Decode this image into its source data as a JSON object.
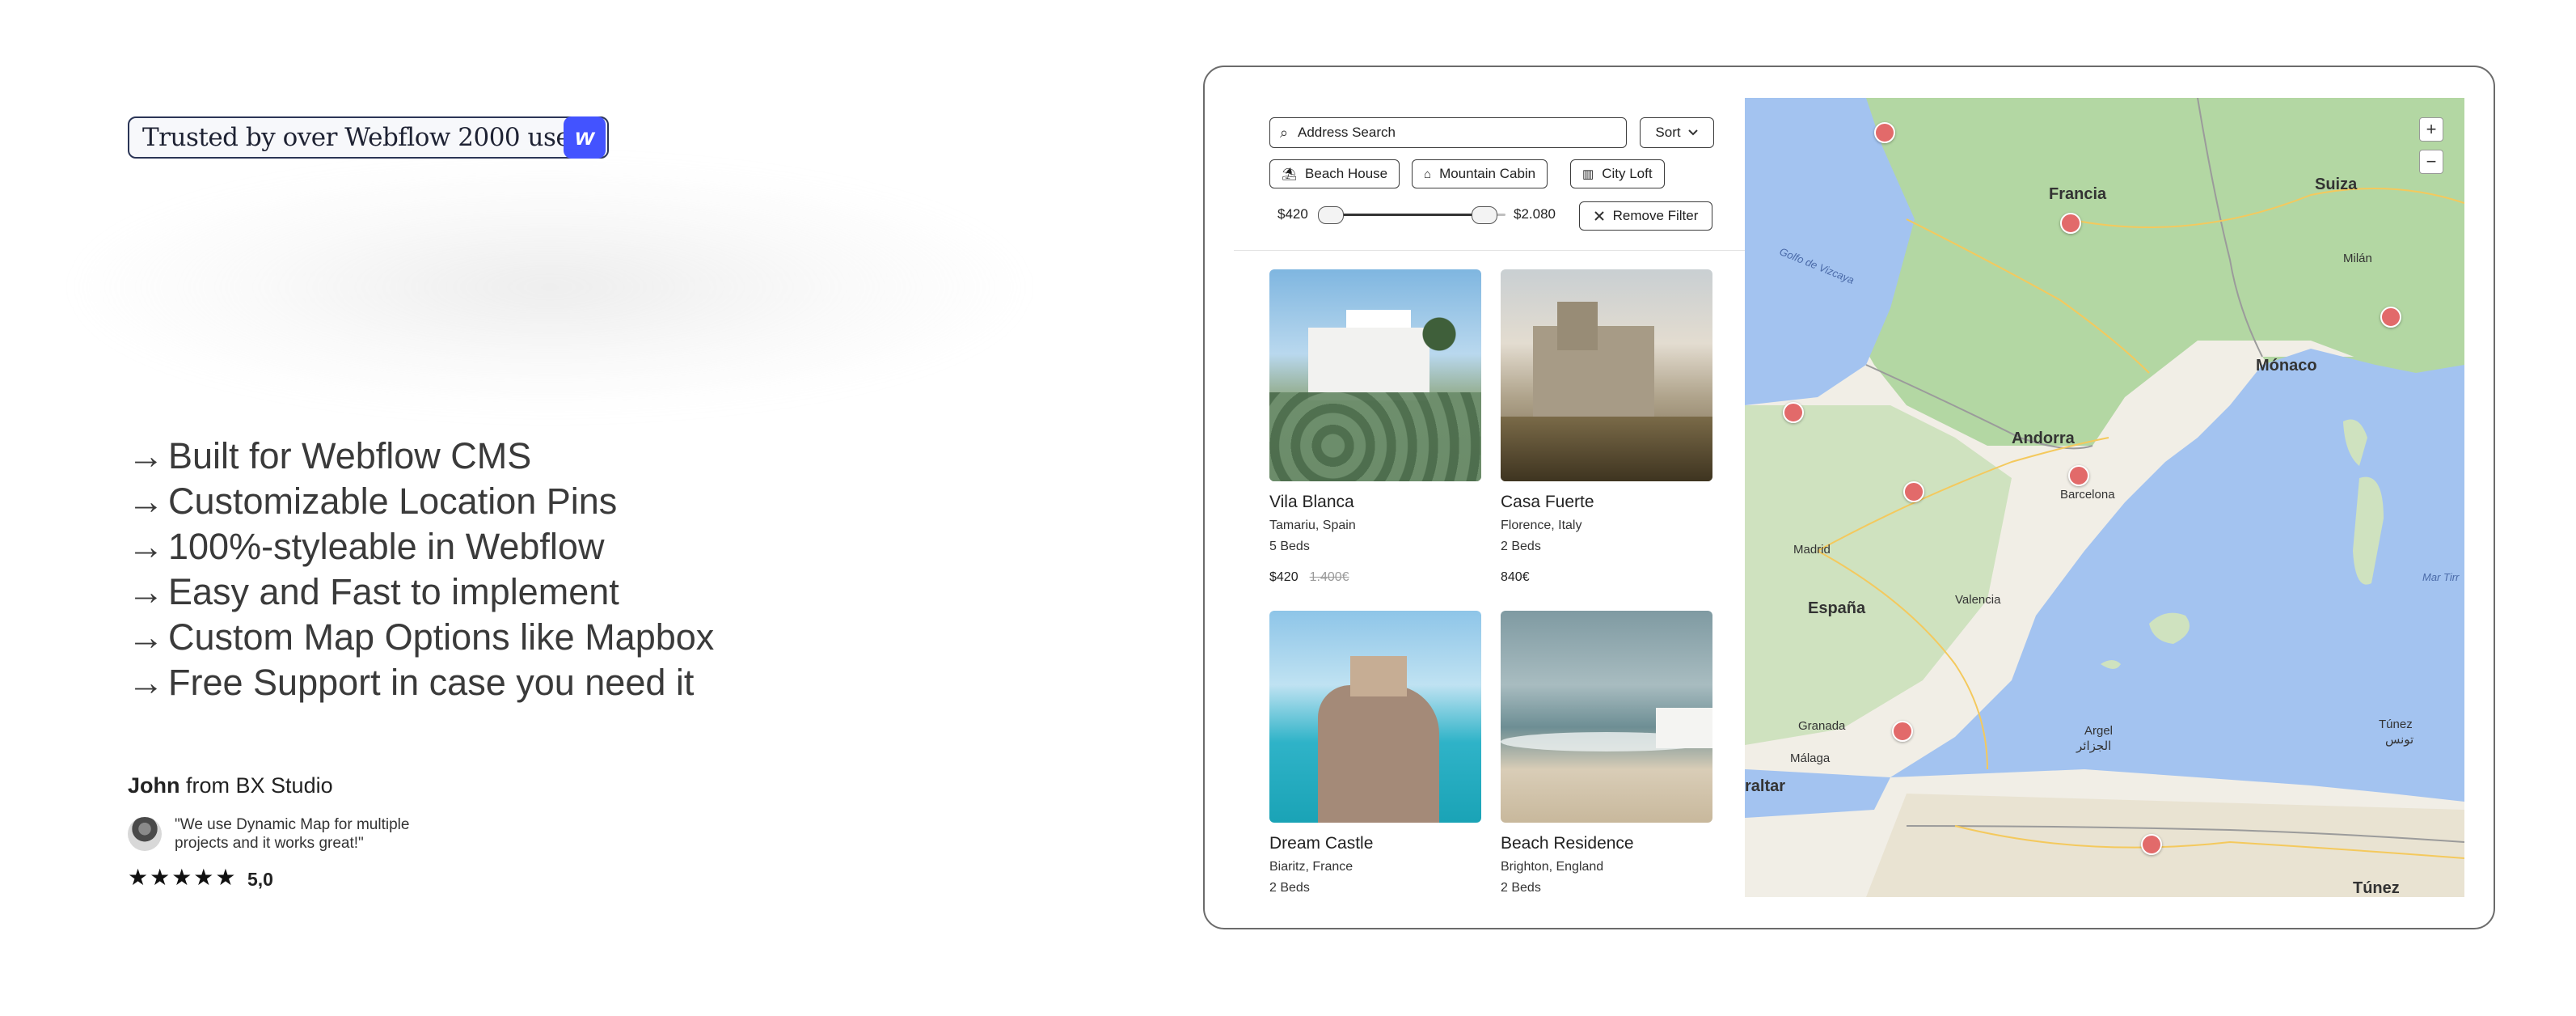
{
  "left": {
    "trust_badge": "Trusted by over Webflow 2000 users",
    "webflow_logo_letter": "w",
    "features": [
      {
        "arrow": "→",
        "text": "Built for Webflow CMS"
      },
      {
        "arrow": "→",
        "text": "Customizable Location Pins"
      },
      {
        "arrow": "→",
        "text": "100%-styleable in Webflow"
      },
      {
        "arrow": "→",
        "text": "Easy and Fast to implement"
      },
      {
        "arrow": "→",
        "text": "Custom Map Options like Mapbox"
      },
      {
        "arrow": "→",
        "text": "Free Support in case you need it"
      }
    ],
    "testimonial": {
      "name": "John",
      "from": "from BX Studio",
      "quote": "\"We use Dynamic Map for multiple projects and it works great!\"",
      "stars": "★★★★★",
      "rating": "5,0"
    }
  },
  "filters": {
    "search_placeholder": "Address Search",
    "sort_label": "Sort",
    "chips": [
      "Beach House",
      "Mountain Cabin",
      "City Loft"
    ],
    "price_min": "$420",
    "price_max": "$2.080",
    "remove_filter": "Remove Filter"
  },
  "listings": [
    {
      "name": "Vila Blanca",
      "location": "Tamariu, Spain",
      "beds": "5 Beds",
      "price": "$420",
      "old_price": "1.400€"
    },
    {
      "name": "Casa Fuerte",
      "location": "Florence, Italy",
      "beds": "2 Beds",
      "price": "840€",
      "old_price": ""
    },
    {
      "name": "Dream Castle",
      "location": "Biaritz, France",
      "beds": "2 Beds"
    },
    {
      "name": "Beach Residence",
      "location": "Brighton, England",
      "beds": "2 Beds"
    }
  ],
  "map": {
    "labels": {
      "francia": "Francia",
      "suiza": "Suiza",
      "milan": "Milán",
      "monaco": "Mónaco",
      "golfo": "Golfo de Vizcaya",
      "andorra": "Andorra",
      "barcelona": "Barcelona",
      "madrid": "Madrid",
      "valencia": "Valencia",
      "espana": "España",
      "mar_tirreno": "Mar Tirr",
      "granada": "Granada",
      "malaga": "Málaga",
      "argel": "Argel",
      "argel_ar": "الجزائر",
      "tunez": "Túnez",
      "tunez_ar": "تونس",
      "gibraltar": "raltar",
      "tunez_country": "Túnez"
    },
    "zoom_in": "+",
    "zoom_out": "−",
    "colors": {
      "water": "#a3c3f0",
      "land": "#f1eee6",
      "forest": "#a9d29a",
      "pin": "#e26a6a"
    }
  }
}
